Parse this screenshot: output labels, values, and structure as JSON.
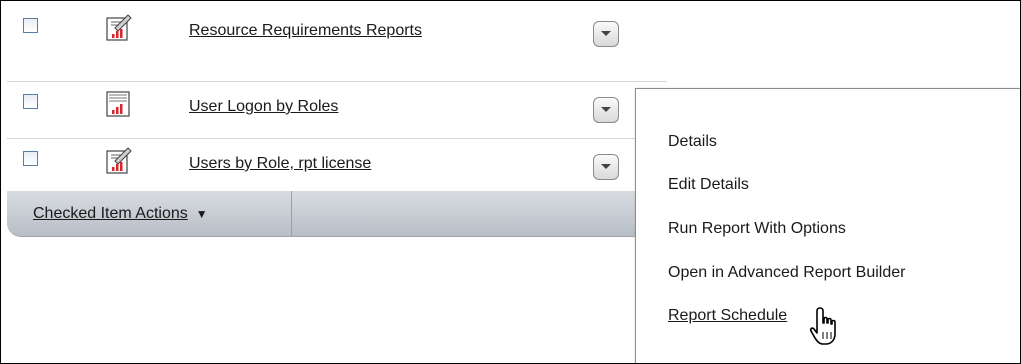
{
  "rows": [
    {
      "label": "Resource Requirements Reports",
      "icon": "report-edit-icon"
    },
    {
      "label": "User Logon by Roles",
      "icon": "report-list-icon"
    },
    {
      "label": "Users by Role, rpt license",
      "icon": "report-edit-icon"
    }
  ],
  "actions_bar": {
    "label": "Checked Item Actions",
    "caret": "▼"
  },
  "menu": {
    "items": [
      "Details",
      "Edit Details",
      "Run Report With Options",
      "Open in Advanced Report Builder",
      "Report Schedule"
    ]
  },
  "colors": {
    "checkbox_border": "#5a7aa3",
    "chart_red": "#d9252b",
    "toolbar_gray": "#c4c9cf"
  }
}
